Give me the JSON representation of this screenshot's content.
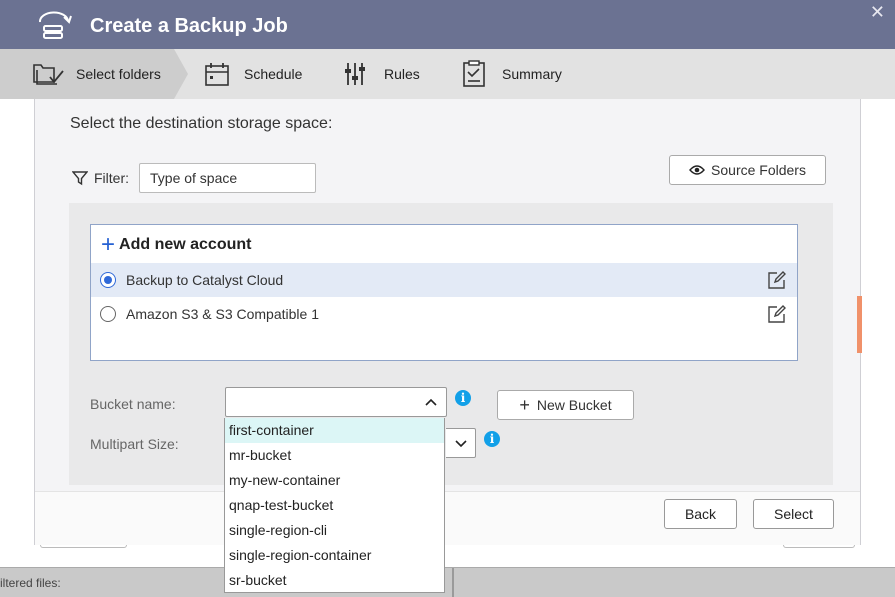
{
  "window": {
    "title": "Create a Backup Job"
  },
  "steps": [
    {
      "label": "Select folders",
      "active": true
    },
    {
      "label": "Schedule",
      "active": false
    },
    {
      "label": "Rules",
      "active": false
    },
    {
      "label": "Summary",
      "active": false
    }
  ],
  "main": {
    "prompt": "Select the destination storage space:",
    "filter": {
      "label": "Filter:",
      "value": "Type of space"
    },
    "source_folders_label": "Source Folders",
    "add_account_label": "Add new account",
    "accounts": [
      {
        "name": "Backup to Catalyst Cloud",
        "selected": true
      },
      {
        "name": "Amazon S3 & S3 Compatible 1",
        "selected": false
      }
    ],
    "bucket_name_label": "Bucket name:",
    "bucket_name_value": "",
    "multipart_size_label": "Multipart Size:",
    "new_bucket_label": "New Bucket",
    "info_glyph": "i"
  },
  "bucket_options": [
    "first-container",
    "mr-bucket",
    "my-new-container",
    "qnap-test-bucket",
    "single-region-cli",
    "single-region-container",
    "sr-bucket"
  ],
  "highlighted_option": "first-container",
  "footer": {
    "back_label": "Back",
    "select_label": "Select"
  },
  "background": {
    "status_text": "iltered files:"
  },
  "colors": {
    "header": "#6b7292",
    "accent": "#2561d3",
    "info": "#12a0e8",
    "scroll_indicator": "#f0916a",
    "highlight": "#dcf6f6"
  }
}
